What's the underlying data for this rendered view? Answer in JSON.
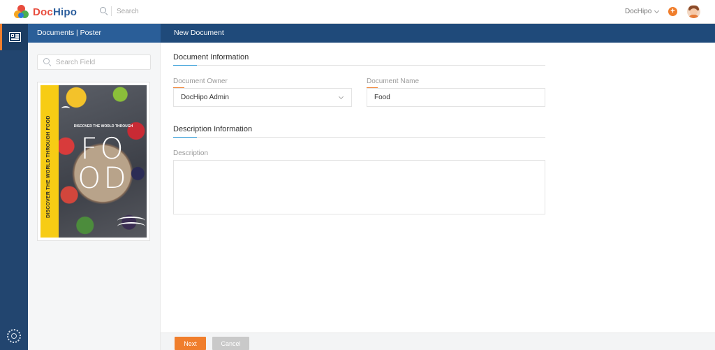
{
  "brand": {
    "name_part1": "Doc",
    "name_part2": "Hipo"
  },
  "topbar": {
    "search_placeholder": "Search",
    "user_menu_label": "DocHipo",
    "add_label": "+"
  },
  "sidebar": {
    "items": [
      {
        "icon": "document-icon",
        "active": true
      },
      {
        "icon": "gear-icon",
        "active": false
      }
    ]
  },
  "header": {
    "breadcrumb": "Documents | Poster",
    "title": "New Document"
  },
  "templates": {
    "search_placeholder": "Search Field",
    "selected": {
      "vertical_text": "DISCOVER THE WORLD THROUGH FOOD",
      "small_text": "DISCOVER THE WORLD THROUGH",
      "big_text_line1": "FO",
      "big_text_line2": "OD"
    }
  },
  "form": {
    "document_section_title": "Document Information",
    "owner_label": "Document Owner",
    "owner_value": "DocHipo Admin",
    "name_label": "Document Name",
    "name_value": "Food",
    "description_section_title": "Description Information",
    "description_label": "Description",
    "description_value": ""
  },
  "footer": {
    "next_label": "Next",
    "cancel_label": "Cancel"
  },
  "colors": {
    "accent": "#f07e2c",
    "navy": "#22456f",
    "header_blue": "#1f4a7a",
    "poster_yellow": "#f7cc14"
  }
}
